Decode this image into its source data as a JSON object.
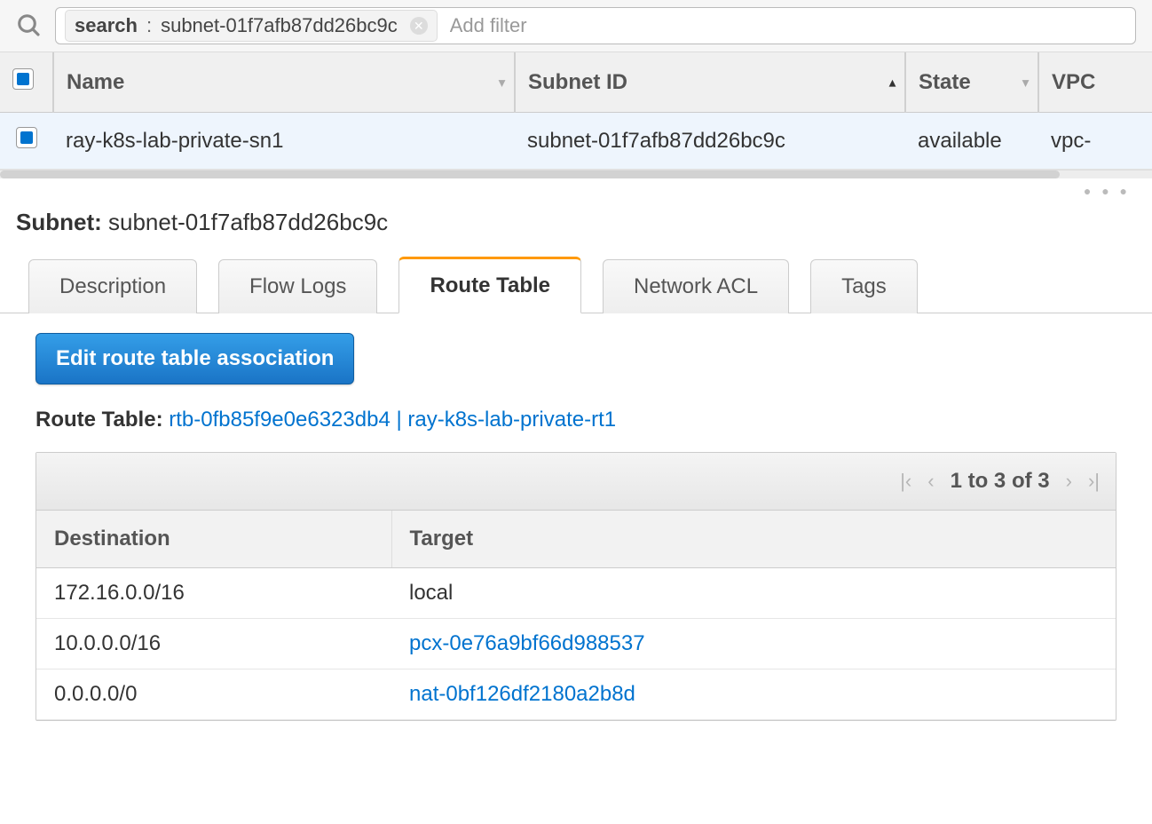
{
  "search": {
    "tag_key": "search",
    "tag_value": "subnet-01f7afb87dd26bc9c",
    "placeholder": "Add filter"
  },
  "grid": {
    "columns": {
      "name": "Name",
      "subnet_id": "Subnet ID",
      "state": "State",
      "vpc": "VPC"
    },
    "rows": [
      {
        "name": "ray-k8s-lab-private-sn1",
        "subnet_id": "subnet-01f7afb87dd26bc9c",
        "state": "available",
        "vpc": "vpc-"
      }
    ]
  },
  "detail": {
    "label": "Subnet:",
    "subnet_id": "subnet-01f7afb87dd26bc9c"
  },
  "tabs": {
    "description": "Description",
    "flow_logs": "Flow Logs",
    "route_table": "Route Table",
    "network_acl": "Network ACL",
    "tags": "Tags"
  },
  "route_table_panel": {
    "edit_button": "Edit route table association",
    "label": "Route Table:",
    "rtb_link": "rtb-0fb85f9e0e6323db4 | ray-k8s-lab-private-rt1",
    "pager": "1 to 3 of 3",
    "columns": {
      "destination": "Destination",
      "target": "Target"
    },
    "routes": [
      {
        "destination": "172.16.0.0/16",
        "target": "local",
        "target_is_link": false
      },
      {
        "destination": "10.0.0.0/16",
        "target": "pcx-0e76a9bf66d988537",
        "target_is_link": true
      },
      {
        "destination": "0.0.0.0/0",
        "target": "nat-0bf126df2180a2b8d",
        "target_is_link": true
      }
    ]
  }
}
